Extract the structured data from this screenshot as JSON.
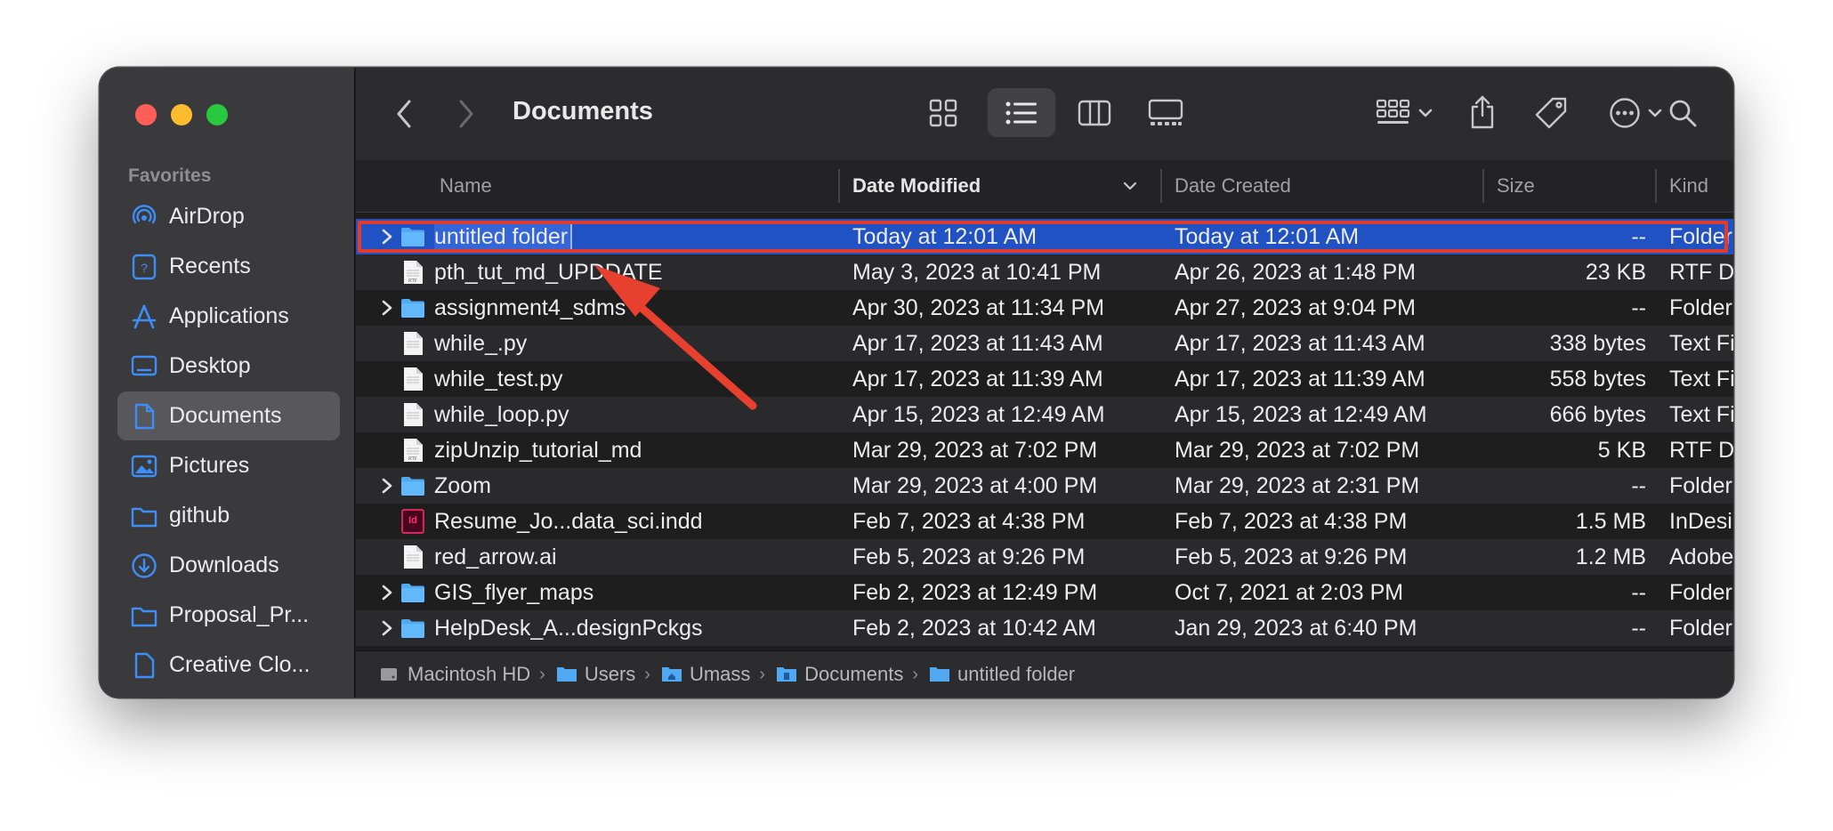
{
  "window": {
    "title": "Documents"
  },
  "sidebar": {
    "section": "Favorites",
    "items": [
      {
        "label": "AirDrop",
        "icon": "airdrop-icon"
      },
      {
        "label": "Recents",
        "icon": "recents-icon"
      },
      {
        "label": "Applications",
        "icon": "applications-icon"
      },
      {
        "label": "Desktop",
        "icon": "desktop-icon"
      },
      {
        "label": "Documents",
        "icon": "documents-icon",
        "active": true
      },
      {
        "label": "Pictures",
        "icon": "pictures-icon"
      },
      {
        "label": "github",
        "icon": "folder-icon"
      },
      {
        "label": "Downloads",
        "icon": "downloads-icon"
      },
      {
        "label": "Proposal_Pr...",
        "icon": "folder-icon"
      },
      {
        "label": "Creative Clo...",
        "icon": "document-icon"
      }
    ]
  },
  "columns": {
    "name": "Name",
    "date_modified": "Date Modified",
    "date_created": "Date Created",
    "size": "Size",
    "kind": "Kind"
  },
  "files": [
    {
      "name": "untitled folder",
      "modified": "Today at 12:01 AM",
      "created": "Today at 12:01 AM",
      "size": "--",
      "kind": "Folder",
      "type": "folder",
      "selected": true
    },
    {
      "name": "pth_tut_md_UPDDATE",
      "modified": "May 3, 2023 at 10:41 PM",
      "created": "Apr 26, 2023 at 1:48 PM",
      "size": "23 KB",
      "kind": "RTF Document",
      "type": "rtf"
    },
    {
      "name": "assignment4_sdms",
      "modified": "Apr 30, 2023 at 11:34 PM",
      "created": "Apr 27, 2023 at 9:04 PM",
      "size": "--",
      "kind": "Folder",
      "type": "folder"
    },
    {
      "name": "while_.py",
      "modified": "Apr 17, 2023 at 11:43 AM",
      "created": "Apr 17, 2023 at 11:43 AM",
      "size": "338 bytes",
      "kind": "Text File",
      "type": "text"
    },
    {
      "name": "while_test.py",
      "modified": "Apr 17, 2023 at 11:39 AM",
      "created": "Apr 17, 2023 at 11:39 AM",
      "size": "558 bytes",
      "kind": "Text File",
      "type": "text"
    },
    {
      "name": "while_loop.py",
      "modified": "Apr 15, 2023 at 12:49 AM",
      "created": "Apr 15, 2023 at 12:49 AM",
      "size": "666 bytes",
      "kind": "Text File",
      "type": "text"
    },
    {
      "name": "zipUnzip_tutorial_md",
      "modified": "Mar 29, 2023 at 7:02 PM",
      "created": "Mar 29, 2023 at 7:02 PM",
      "size": "5 KB",
      "kind": "RTF Document",
      "type": "rtf"
    },
    {
      "name": "Zoom",
      "modified": "Mar 29, 2023 at 4:00 PM",
      "created": "Mar 29, 2023 at 2:31 PM",
      "size": "--",
      "kind": "Folder",
      "type": "folder"
    },
    {
      "name": "Resume_Jo...data_sci.indd",
      "modified": "Feb 7, 2023 at 4:38 PM",
      "created": "Feb 7, 2023 at 4:38 PM",
      "size": "1.5 MB",
      "kind": "InDesig...ument",
      "type": "indd"
    },
    {
      "name": "red_arrow.ai",
      "modified": "Feb 5, 2023 at 9:26 PM",
      "created": "Feb 5, 2023 at 9:26 PM",
      "size": "1.2 MB",
      "kind": "Adobe...cument",
      "type": "ai"
    },
    {
      "name": "GIS_flyer_maps",
      "modified": "Feb 2, 2023 at 12:49 PM",
      "created": "Oct 7, 2021 at 2:03 PM",
      "size": "--",
      "kind": "Folder",
      "type": "folder"
    },
    {
      "name": "HelpDesk_A...designPckgs",
      "modified": "Feb 2, 2023 at 10:42 AM",
      "created": "Jan 29, 2023 at 6:40 PM",
      "size": "--",
      "kind": "Folder",
      "type": "folder"
    }
  ],
  "pathbar": [
    {
      "label": "Macintosh HD",
      "icon": "hard-drive-icon"
    },
    {
      "label": "Users",
      "icon": "folder-icon"
    },
    {
      "label": "Umass",
      "icon": "home-folder-icon"
    },
    {
      "label": "Documents",
      "icon": "documents-folder-icon"
    },
    {
      "label": "untitled folder",
      "icon": "folder-icon"
    }
  ],
  "colors": {
    "selection": "#2152c4",
    "annotation": "#e03b2c",
    "folder": "#4fa8f0"
  }
}
